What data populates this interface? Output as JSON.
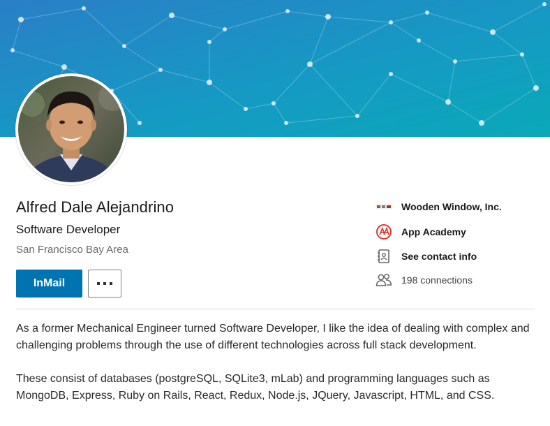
{
  "profile": {
    "name": "Alfred Dale Alejandrino",
    "headline": "Software Developer",
    "location": "San Francisco Bay Area"
  },
  "actions": {
    "inmail_label": "InMail",
    "more_label": "···"
  },
  "side_info": {
    "company": "Wooden Window, Inc.",
    "school": "App Academy",
    "contact": "See contact info",
    "connections": "198 connections",
    "company_logo_text": "WOODEN WINDOW",
    "school_logo_text": "a/A"
  },
  "summary": {
    "paragraph_1": "As a former Mechanical Engineer turned Software Developer, I like the idea of dealing with complex and challenging problems through the use of different technologies across full stack development.",
    "paragraph_2": "These consist of databases (postgreSQL, SQLite3, mLab) and programming languages such as MongoDB, Express, Ruby on Rails, React, Redux, Node.js, JQuery, Javascript, HTML, and CSS."
  },
  "colors": {
    "banner_start": "#2a7fc6",
    "banner_end": "#0aa9b8",
    "primary_button": "#0073b1",
    "school_logo": "#e0332f"
  },
  "icons": {
    "more": "ellipsis-icon",
    "contact": "address-book-icon",
    "connections": "people-icon"
  }
}
